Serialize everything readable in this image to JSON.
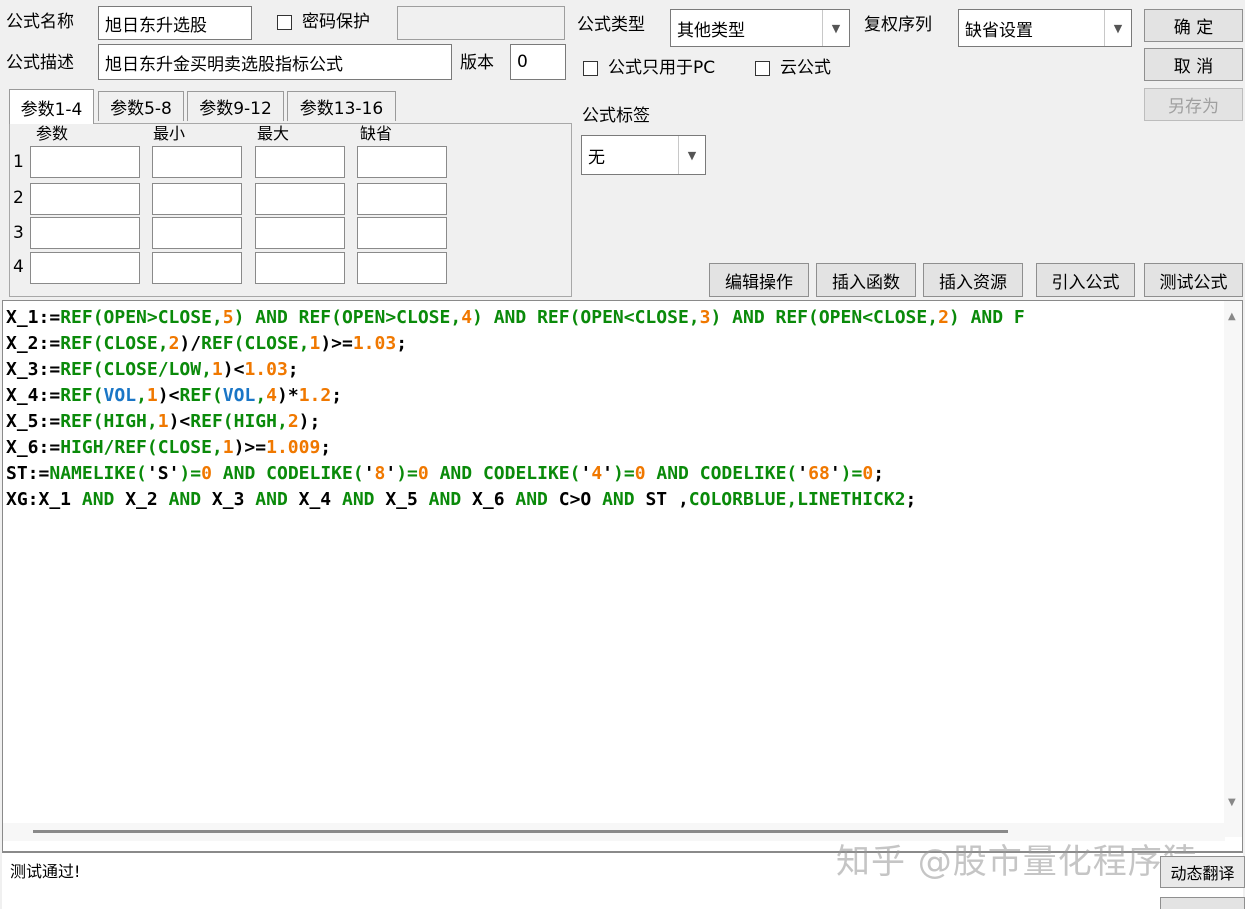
{
  "header": {
    "name_label": "公式名称",
    "name_value": "旭日东升选股",
    "password_label": "密码保护",
    "password_value": "",
    "desc_label": "公式描述",
    "desc_value": "旭日东升金买明卖选股指标公式",
    "version_label": "版本",
    "version_value": "0",
    "type_label": "公式类型",
    "type_value": "其他类型",
    "fuquan_label": "复权序列",
    "fuquan_value": "缺省设置",
    "pc_only_label": "公式只用于PC",
    "cloud_label": "云公式",
    "tag_label": "公式标签",
    "tag_value": "无"
  },
  "buttons": {
    "confirm": "确 定",
    "cancel": "取 消",
    "save_as": "另存为",
    "edit_ops": "编辑操作",
    "insert_func": "插入函数",
    "insert_res": "插入资源",
    "import_formula": "引入公式",
    "test_formula": "测试公式",
    "dynamic_translate": "动态翻译"
  },
  "params": {
    "tabs": [
      "参数1-4",
      "参数5-8",
      "参数9-12",
      "参数13-16"
    ],
    "active_tab": 0,
    "columns": [
      "参数",
      "最小",
      "最大",
      "缺省"
    ],
    "rows": [
      "1",
      "2",
      "3",
      "4"
    ]
  },
  "colors": {
    "keyword": "#000000",
    "function": "#0a8a0a",
    "number": "#f07800",
    "variable": "#1a76c6"
  },
  "code": [
    [
      [
        "X_1:=",
        "k"
      ],
      [
        "REF(OPEN>CLOSE,",
        "f"
      ],
      [
        "5",
        "n"
      ],
      [
        ") AND ",
        "f"
      ],
      [
        "REF(OPEN>CLOSE,",
        "f"
      ],
      [
        "4",
        "n"
      ],
      [
        ") AND ",
        "f"
      ],
      [
        "REF(OPEN<CLOSE,",
        "f"
      ],
      [
        "3",
        "n"
      ],
      [
        ") AND ",
        "f"
      ],
      [
        "REF(OPEN<CLOSE,",
        "f"
      ],
      [
        "2",
        "n"
      ],
      [
        ") AND F",
        "f"
      ]
    ],
    [
      [
        "X_2:=",
        "k"
      ],
      [
        "REF(CLOSE,",
        "f"
      ],
      [
        "2",
        "n"
      ],
      [
        ")/",
        "k"
      ],
      [
        "REF(CLOSE,",
        "f"
      ],
      [
        "1",
        "n"
      ],
      [
        ")>=",
        "k"
      ],
      [
        "1.03",
        "n"
      ],
      [
        ";",
        "k"
      ]
    ],
    [
      [
        "X_3:=",
        "k"
      ],
      [
        "REF(CLOSE/LOW,",
        "f"
      ],
      [
        "1",
        "n"
      ],
      [
        ")<",
        "k"
      ],
      [
        "1.03",
        "n"
      ],
      [
        ";",
        "k"
      ]
    ],
    [
      [
        "X_4:=",
        "k"
      ],
      [
        "REF(",
        "f"
      ],
      [
        "VOL",
        "v"
      ],
      [
        ",",
        "f"
      ],
      [
        "1",
        "n"
      ],
      [
        ")<",
        "k"
      ],
      [
        "REF(",
        "f"
      ],
      [
        "VOL",
        "v"
      ],
      [
        ",",
        "f"
      ],
      [
        "4",
        "n"
      ],
      [
        ")*",
        "k"
      ],
      [
        "1.2",
        "n"
      ],
      [
        ";",
        "k"
      ]
    ],
    [
      [
        "X_5:=",
        "k"
      ],
      [
        "REF(HIGH,",
        "f"
      ],
      [
        "1",
        "n"
      ],
      [
        ")<",
        "k"
      ],
      [
        "REF(HIGH,",
        "f"
      ],
      [
        "2",
        "n"
      ],
      [
        ");",
        "k"
      ]
    ],
    [
      [
        "X_6:=",
        "k"
      ],
      [
        "HIGH/",
        "f"
      ],
      [
        "REF(CLOSE,",
        "f"
      ],
      [
        "1",
        "n"
      ],
      [
        ")>=",
        "k"
      ],
      [
        "1.009",
        "n"
      ],
      [
        ";",
        "k"
      ]
    ],
    [
      [
        "ST:=",
        "k"
      ],
      [
        "NAMELIKE(",
        "f"
      ],
      [
        "'S'",
        "k"
      ],
      [
        ")=",
        "f"
      ],
      [
        "0",
        "n"
      ],
      [
        " AND ",
        "f"
      ],
      [
        "CODELIKE(",
        "f"
      ],
      [
        "'",
        "k"
      ],
      [
        "8",
        "n"
      ],
      [
        "'",
        "k"
      ],
      [
        ")=",
        "f"
      ],
      [
        "0",
        "n"
      ],
      [
        " AND ",
        "f"
      ],
      [
        "CODELIKE(",
        "f"
      ],
      [
        "'",
        "k"
      ],
      [
        "4",
        "n"
      ],
      [
        "'",
        "k"
      ],
      [
        ")=",
        "f"
      ],
      [
        "0",
        "n"
      ],
      [
        " AND ",
        "f"
      ],
      [
        "CODELIKE(",
        "f"
      ],
      [
        "'",
        "k"
      ],
      [
        "68",
        "n"
      ],
      [
        "'",
        "k"
      ],
      [
        ")=",
        "f"
      ],
      [
        "0",
        "n"
      ],
      [
        ";",
        "k"
      ]
    ],
    [
      [
        "XG:X_1",
        "k"
      ],
      [
        " AND ",
        "f"
      ],
      [
        "X_2",
        "k"
      ],
      [
        " AND ",
        "f"
      ],
      [
        "X_3",
        "k"
      ],
      [
        " AND ",
        "f"
      ],
      [
        "X_4",
        "k"
      ],
      [
        " AND ",
        "f"
      ],
      [
        "X_5",
        "k"
      ],
      [
        " AND ",
        "f"
      ],
      [
        "X_6",
        "k"
      ],
      [
        " AND ",
        "f"
      ],
      [
        "C>O",
        "k"
      ],
      [
        " AND ",
        "f"
      ],
      [
        "ST ,",
        "k"
      ],
      [
        "COLORBLUE,LINETHICK2",
        "f"
      ],
      [
        ";",
        "k"
      ]
    ]
  ],
  "status": {
    "message": "测试通过!"
  },
  "watermark": "知乎 @股市量化程序猿"
}
